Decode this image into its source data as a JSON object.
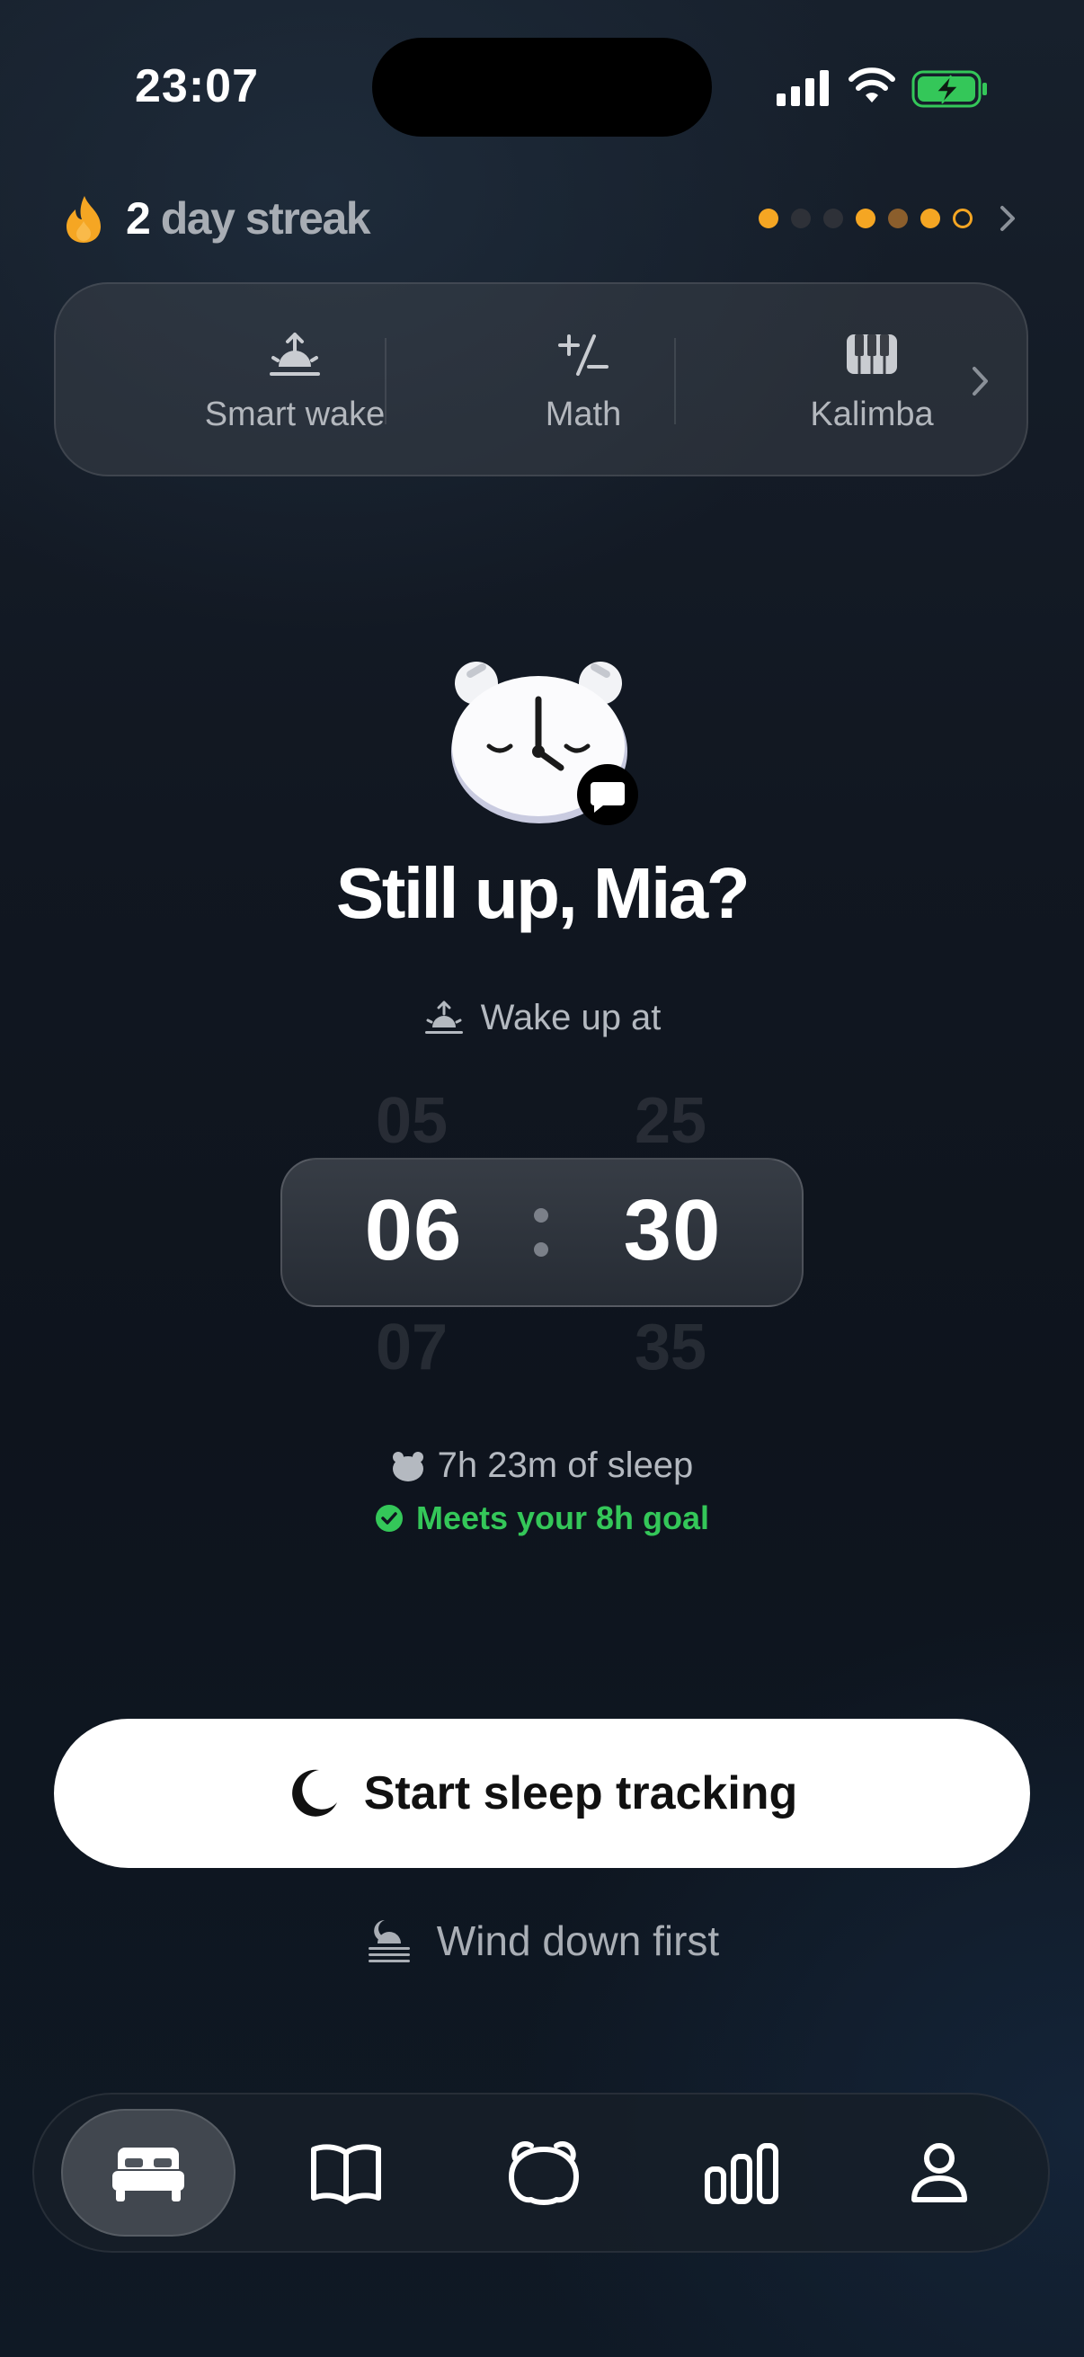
{
  "status_bar": {
    "time": "23:07"
  },
  "streak": {
    "count": "2",
    "label": "day streak",
    "dots": [
      "#f5a623",
      "#2e3138",
      "#2e3138",
      "#f5a623",
      "#8b5e2c",
      "#f5a623",
      "outline"
    ]
  },
  "features": [
    {
      "label": "Smart wake",
      "icon": "sunrise-icon"
    },
    {
      "label": "Math",
      "icon": "math-icon"
    },
    {
      "label": "Kalimba",
      "icon": "piano-keys-icon"
    }
  ],
  "greeting": "Still up, Mia?",
  "wake": {
    "label": "Wake up at"
  },
  "picker": {
    "hour_prev": "05",
    "hour": "06",
    "hour_next": "07",
    "minute_prev": "25",
    "minute": "30",
    "minute_next": "35"
  },
  "sleep": {
    "duration": "7h 23m of sleep",
    "goal": "Meets your 8h goal"
  },
  "start_button": {
    "label": "Start sleep tracking"
  },
  "wind_down": {
    "label": "Wind down first"
  },
  "tabs": [
    {
      "icon": "bed-icon",
      "active": true
    },
    {
      "icon": "book-icon",
      "active": false
    },
    {
      "icon": "alarm-mascot-icon",
      "active": false
    },
    {
      "icon": "stats-icon",
      "active": false
    },
    {
      "icon": "profile-icon",
      "active": false
    }
  ],
  "colors": {
    "accent_orange": "#f5a623",
    "goal_green": "#34c759",
    "battery_green": "#34c759"
  }
}
